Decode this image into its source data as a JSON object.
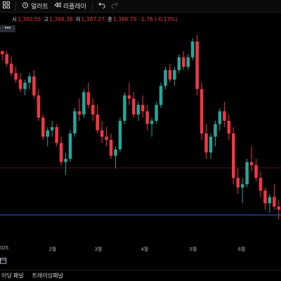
{
  "toolbar": {
    "layout_icon": "grid-layout-icon",
    "alert_icon": "alarm-clock-icon",
    "alert_label": "얼러트",
    "replay_icon": "replay-rewind-icon",
    "replay_label": "리플레이",
    "undo_icon": "undo-icon",
    "redo_icon": "redo-icon"
  },
  "legend": {
    "open_label": "시",
    "open": "1,392.55",
    "high_label": "고",
    "high": "1,394.38",
    "low_label": "저",
    "low": "1,387.27",
    "close_label": "종",
    "close": "1,390.79",
    "change": "-1.76 (-0.13%)"
  },
  "more_button": "•••",
  "x_axis": {
    "labels": [
      "025",
      "2월",
      "3월",
      "4월",
      "5월",
      "6월"
    ]
  },
  "bottom_tabs": [
    "이딩 패널",
    "트레이딩패널"
  ],
  "colors": {
    "up": "#26a69a",
    "down": "#f23645",
    "hline": "#2962ff",
    "hline2": "#4a1518",
    "background": "#000000"
  },
  "chart_data": {
    "type": "candlestick",
    "series": [
      {
        "name": "",
        "candles": [
          [
            1,
            1,
            0.97,
            0.99
          ],
          [
            0.99,
            1.0,
            0.95,
            0.96
          ],
          [
            0.96,
            0.98,
            0.92,
            0.93
          ],
          [
            0.93,
            0.95,
            0.9,
            0.91
          ],
          [
            0.91,
            0.93,
            0.87,
            0.88
          ],
          [
            0.88,
            0.91,
            0.86,
            0.9
          ],
          [
            0.9,
            0.93,
            0.88,
            0.92
          ],
          [
            0.92,
            0.94,
            0.85,
            0.86
          ],
          [
            0.86,
            0.88,
            0.78,
            0.79
          ],
          [
            0.79,
            0.8,
            0.72,
            0.73
          ],
          [
            0.73,
            0.76,
            0.7,
            0.75
          ],
          [
            0.75,
            0.78,
            0.73,
            0.76
          ],
          [
            0.76,
            0.77,
            0.7,
            0.71
          ],
          [
            0.71,
            0.73,
            0.64,
            0.65
          ],
          [
            0.65,
            0.68,
            0.61,
            0.66
          ],
          [
            0.66,
            0.75,
            0.65,
            0.74
          ],
          [
            0.74,
            0.82,
            0.73,
            0.81
          ],
          [
            0.81,
            0.85,
            0.78,
            0.8
          ],
          [
            0.8,
            0.88,
            0.79,
            0.87
          ],
          [
            0.87,
            0.9,
            0.82,
            0.83
          ],
          [
            0.83,
            0.85,
            0.78,
            0.8
          ],
          [
            0.8,
            0.83,
            0.74,
            0.75
          ],
          [
            0.75,
            0.78,
            0.71,
            0.73
          ],
          [
            0.73,
            0.76,
            0.7,
            0.72
          ],
          [
            0.72,
            0.74,
            0.66,
            0.67
          ],
          [
            0.67,
            0.7,
            0.63,
            0.69
          ],
          [
            0.69,
            0.79,
            0.68,
            0.78
          ],
          [
            0.78,
            0.87,
            0.77,
            0.86
          ],
          [
            0.86,
            0.9,
            0.83,
            0.85
          ],
          [
            0.85,
            0.87,
            0.79,
            0.8
          ],
          [
            0.8,
            0.84,
            0.78,
            0.83
          ],
          [
            0.83,
            0.86,
            0.79,
            0.81
          ],
          [
            0.81,
            0.83,
            0.75,
            0.77
          ],
          [
            0.77,
            0.79,
            0.73,
            0.78
          ],
          [
            0.78,
            0.84,
            0.77,
            0.83
          ],
          [
            0.83,
            0.9,
            0.82,
            0.89
          ],
          [
            0.89,
            0.95,
            0.88,
            0.94
          ],
          [
            0.94,
            0.96,
            0.9,
            0.91
          ],
          [
            0.91,
            0.95,
            0.89,
            0.94
          ],
          [
            0.94,
            0.99,
            0.93,
            0.98
          ],
          [
            0.98,
            1.0,
            0.94,
            0.95
          ],
          [
            0.95,
            0.99,
            0.94,
            0.98
          ],
          [
            0.98,
            1.04,
            0.97,
            1.03
          ],
          [
            1.03,
            1.05,
            0.86,
            0.88
          ],
          [
            0.88,
            0.9,
            0.72,
            0.74
          ],
          [
            0.74,
            0.77,
            0.66,
            0.68
          ],
          [
            0.68,
            0.74,
            0.66,
            0.73
          ],
          [
            0.73,
            0.78,
            0.7,
            0.77
          ],
          [
            0.77,
            0.82,
            0.75,
            0.81
          ],
          [
            0.81,
            0.84,
            0.76,
            0.78
          ],
          [
            0.78,
            0.8,
            0.72,
            0.74
          ],
          [
            0.74,
            0.76,
            0.58,
            0.6
          ],
          [
            0.6,
            0.63,
            0.55,
            0.57
          ],
          [
            0.57,
            0.6,
            0.52,
            0.58
          ],
          [
            0.58,
            0.66,
            0.57,
            0.65
          ],
          [
            0.65,
            0.7,
            0.62,
            0.64
          ],
          [
            0.64,
            0.66,
            0.59,
            0.6
          ],
          [
            0.6,
            0.62,
            0.54,
            0.56
          ],
          [
            0.56,
            0.57,
            0.5,
            0.52
          ],
          [
            0.52,
            0.55,
            0.49,
            0.54
          ],
          [
            0.54,
            0.58,
            0.5,
            0.51
          ],
          [
            0.51,
            0.53,
            0.47,
            0.5
          ]
        ]
      }
    ]
  }
}
